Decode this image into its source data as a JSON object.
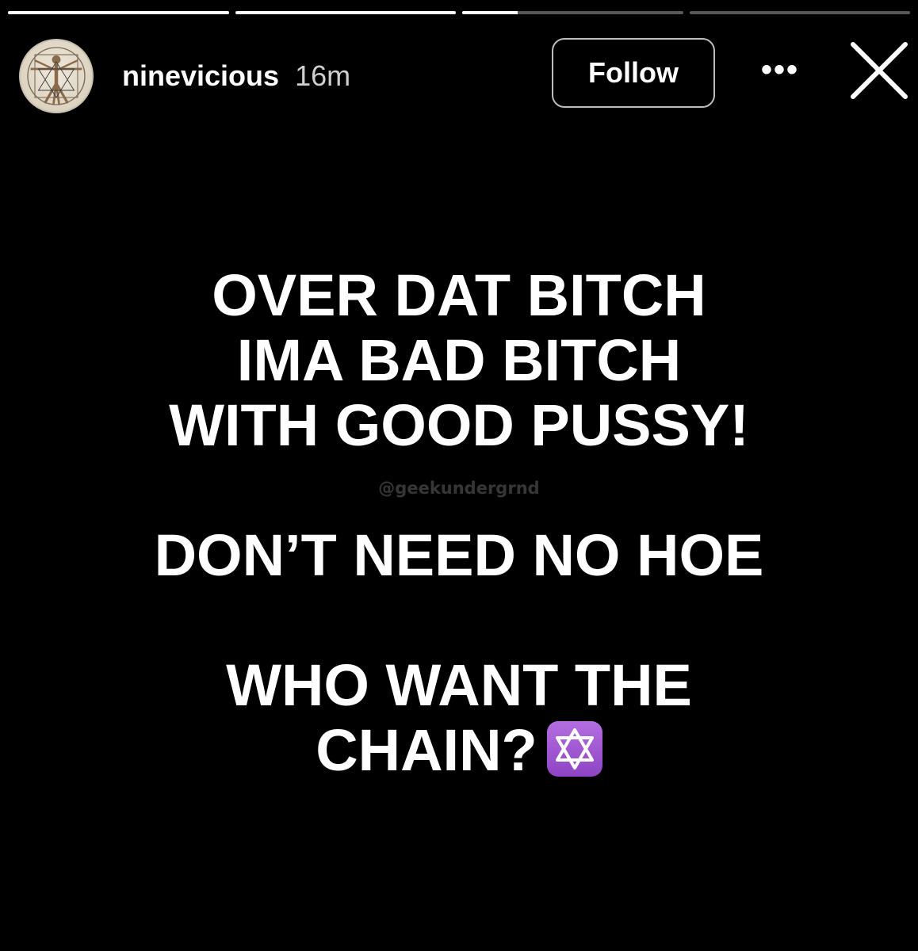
{
  "progress": [
    1,
    1,
    0.25,
    0
  ],
  "header": {
    "username": "ninevicious",
    "time": "16m",
    "follow_label": "Follow",
    "more_icon": "•••"
  },
  "story": {
    "lines": [
      "OVER DAT BITCH",
      "IMA BAD BITCH",
      "WITH GOOD PUSSY!",
      "",
      "DON’T NEED NO HOE",
      "",
      "WHO WANT THE",
      "CHAIN?"
    ],
    "emoji": "star-of-david-icon",
    "watermark": "@geekundergrnd"
  },
  "colors": {
    "background": "#000000",
    "text": "#ffffff",
    "badge": "#9b51cf"
  }
}
